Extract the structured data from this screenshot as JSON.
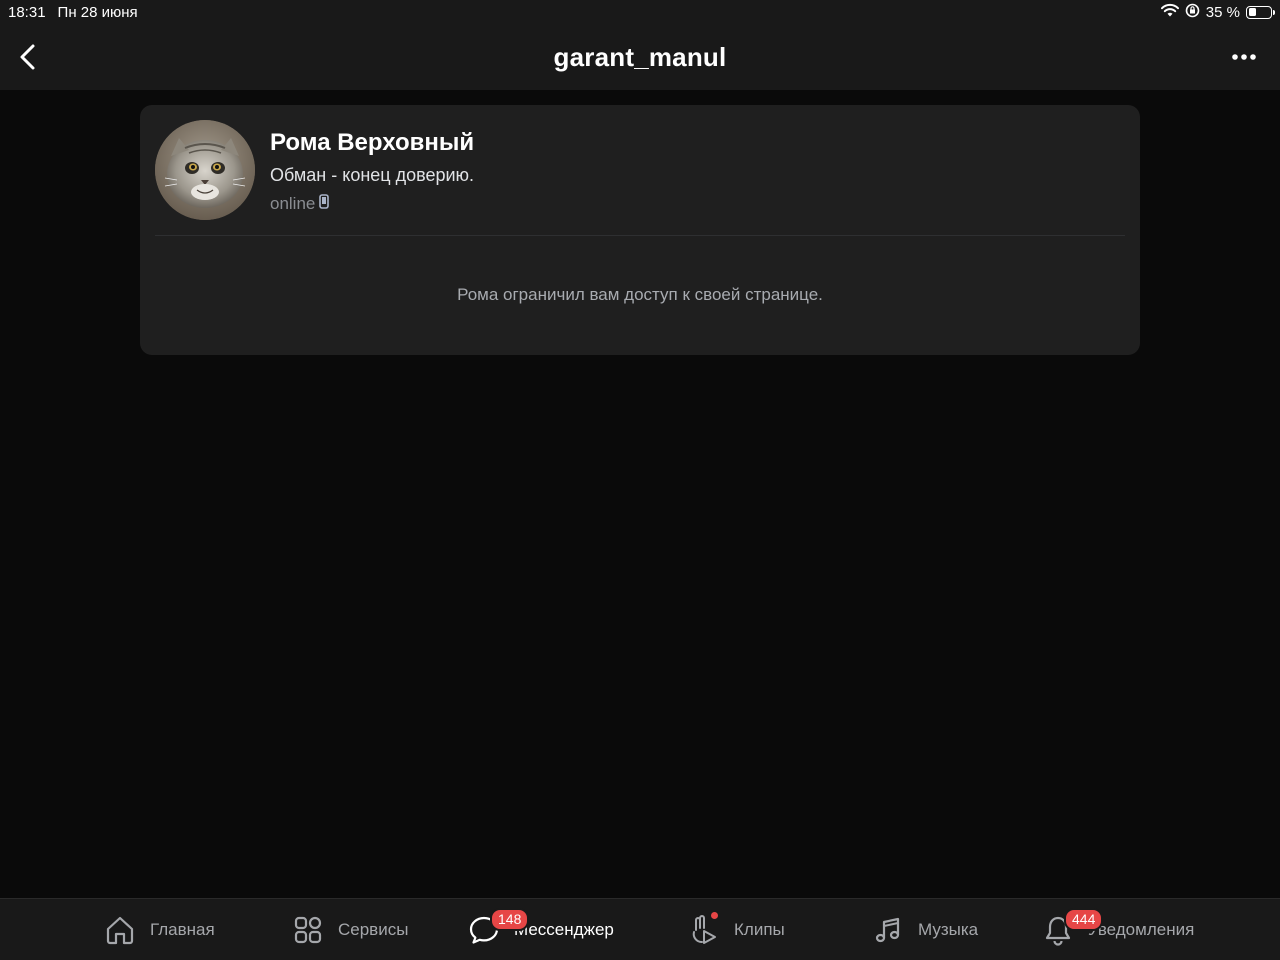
{
  "status_bar": {
    "time": "18:31",
    "date": "Пн 28 июня",
    "battery": "35 %",
    "battery_level": 0.35
  },
  "header": {
    "title": "garant_manul"
  },
  "profile": {
    "name": "Рома Верховный",
    "status": "Обман - конец доверию.",
    "online": "online",
    "restricted_message": "Рома ограничил вам доступ к своей странице."
  },
  "tabs": [
    {
      "label": "Главная",
      "icon": "home-icon"
    },
    {
      "label": "Сервисы",
      "icon": "services-icon"
    },
    {
      "label": "Мессенджер",
      "icon": "messenger-icon",
      "badge": "148"
    },
    {
      "label": "Клипы",
      "icon": "clips-icon",
      "dot": true
    },
    {
      "label": "Музыка",
      "icon": "music-icon"
    },
    {
      "label": "Уведомления",
      "icon": "bell-icon",
      "badge": "444"
    }
  ],
  "colors": {
    "background": "#0a0a0a",
    "surface": "#1f1f1f",
    "bar": "#191919",
    "badge": "#e64646"
  }
}
